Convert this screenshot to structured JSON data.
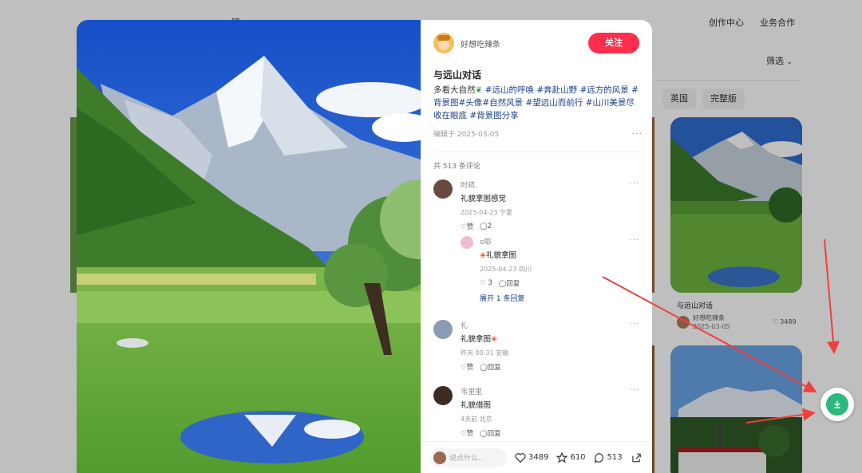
{
  "header": {
    "search_label": "壁",
    "link_creator": "创作中心",
    "link_business": "业务合作"
  },
  "filter": {
    "label": "筛选"
  },
  "tags": [
    "英国",
    "完整版"
  ],
  "card": {
    "title": "与远山对话",
    "author": "好想吃辣条",
    "date": "2025-03-05",
    "likes": "3489"
  },
  "note": {
    "author": "好想吃辣条",
    "follow_label": "关注",
    "title": "与远山对话",
    "desc_lead": "多看大自然",
    "tags": [
      "#远山的呼唤",
      "#奔赴山野",
      "#远方的风景",
      "#背景图",
      "#头像",
      "#自然风景",
      "#望远山而前行",
      "#山川美景尽收在眼底",
      "#背景图分享"
    ],
    "edit_date": "编辑于 2025-03-05",
    "comment_count": "共 513 条评论"
  },
  "comments": [
    {
      "name": "时疏.",
      "text": "礼貌拿图感觉",
      "meta": "2025-04-23 宁夏",
      "like": "赞",
      "reply": "2"
    },
    {
      "name": "o耶",
      "text": "礼貌拿图",
      "meta": "2025-04-23 四川",
      "like": "3",
      "reply": "回复"
    },
    {
      "name": "礼",
      "text": "礼貌拿图",
      "meta": "昨天 00:31 安徽",
      "like": "赞",
      "reply": "回复"
    },
    {
      "name": "韦里里",
      "text": "礼貌借图",
      "meta": "4天前 北京",
      "like": "赞",
      "reply": "回复"
    }
  ],
  "expand_label": "展开 1 条回复",
  "bottom": {
    "placeholder": "说点什么...",
    "likes": "3489",
    "stars": "610",
    "comments": "513"
  },
  "icons": [
    "download-icon",
    "heart-icon",
    "star-icon",
    "comment-icon",
    "share-icon",
    "chevron-down-icon"
  ],
  "colors": {
    "follow": "#ff2e4d",
    "tag": "#1b3f8a",
    "download": "#2ab87d",
    "arrow": "#f0403c"
  }
}
